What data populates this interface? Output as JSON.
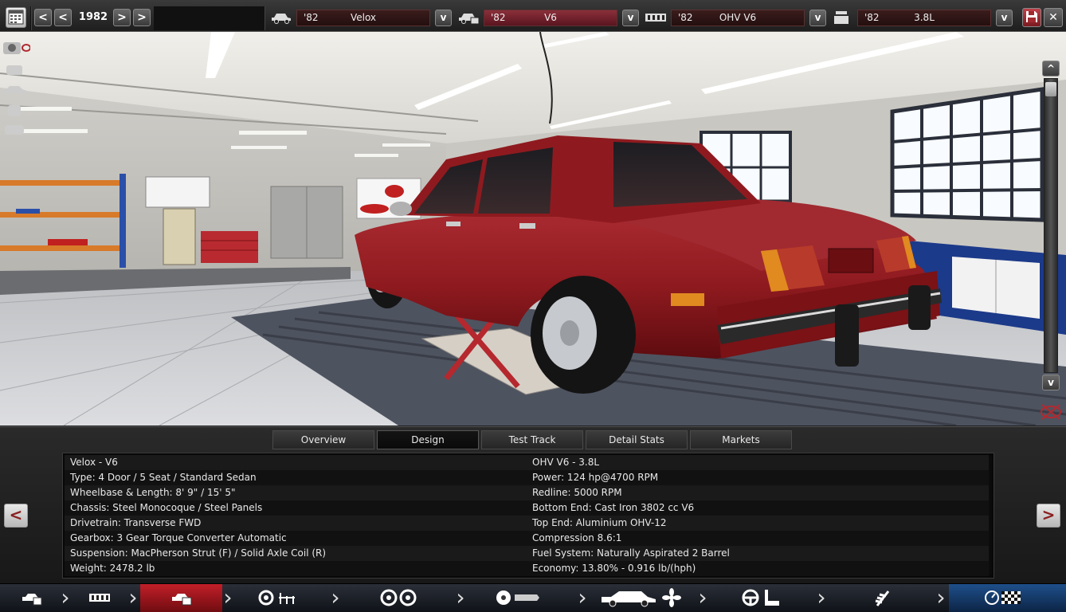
{
  "topbar": {
    "year": "1982",
    "prev_label": "<",
    "prev_fast_label": "<",
    "next_label": ">",
    "next_fast_label": ">",
    "selectors": [
      {
        "year": "'82",
        "name": "Velox",
        "icon": "car-body-icon"
      },
      {
        "year": "'82",
        "name": "V6",
        "icon": "car-trim-icon"
      },
      {
        "year": "'82",
        "name": "OHV V6",
        "icon": "engine-block-icon"
      },
      {
        "year": "'82",
        "name": "3.8L",
        "icon": "engine-variant-icon"
      }
    ],
    "dropdown_label": "v",
    "close_label": "✕"
  },
  "scene": {
    "scroll_up_label": "^",
    "scroll_down_label": "v",
    "car_color": "#8e1a1f"
  },
  "tabs": [
    {
      "label": "Overview",
      "active": false
    },
    {
      "label": "Design",
      "active": true
    },
    {
      "label": "Test Track",
      "active": false
    },
    {
      "label": "Detail Stats",
      "active": false
    },
    {
      "label": "Markets",
      "active": false
    }
  ],
  "info": {
    "left": [
      "Velox - V6",
      "Type: 4 Door / 5 Seat / Standard Sedan",
      "Wheelbase & Length: 8' 9\" / 15' 5\"",
      "Chassis: Steel Monocoque / Steel Panels",
      "Drivetrain: Transverse FWD",
      "Gearbox: 3 Gear Torque Converter Automatic",
      "Suspension: MacPherson Strut (F) / Solid Axle Coil (R)",
      "Weight: 2478.2 lb"
    ],
    "right": [
      "OHV V6 - 3.8L",
      "Power: 124 hp@4700 RPM",
      "Redline: 5000 RPM",
      "Bottom End: Cast Iron 3802 cc V6",
      "Top End: Aluminium OHV-12",
      "Compression 8.6:1",
      "Fuel System: Naturally Aspirated 2 Barrel",
      "Economy: 13.80% - 0.916 lb/(hph)"
    ],
    "prev_label": "<",
    "next_label": ">"
  },
  "bottom_nav": [
    {
      "icon": "car-model-icon",
      "active": false
    },
    {
      "icon": "chassis-icon",
      "active": false
    },
    {
      "icon": "car-trim-icon",
      "active": true
    },
    {
      "icon": "engine-parts-icon",
      "active": false
    },
    {
      "icon": "wheels-icon",
      "active": false
    },
    {
      "icon": "brakes-body-icon",
      "active": false
    },
    {
      "icon": "aero-cooling-icon",
      "active": false
    },
    {
      "icon": "interior-icon",
      "active": false
    },
    {
      "icon": "suspension-icon",
      "active": false
    },
    {
      "icon": "testing-icon",
      "active": false
    }
  ],
  "colors": {
    "accent_red": "#c21f28",
    "highlight_blue": "#1e4f8a"
  }
}
